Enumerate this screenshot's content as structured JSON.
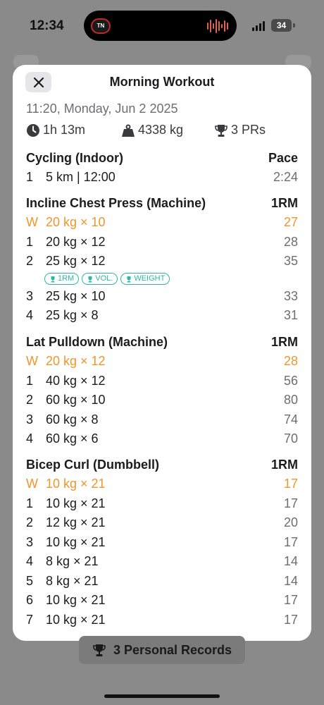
{
  "status_bar": {
    "time": "12:34",
    "battery": "34"
  },
  "modal": {
    "title": "Morning Workout",
    "datetime": "11:20, Monday, Jun 2 2025",
    "stats": {
      "duration": "1h 13m",
      "volume": "4338 kg",
      "prs": "3 PRs"
    }
  },
  "exercises": [
    {
      "name": "Cycling (Indoor)",
      "metric_label": "Pace",
      "sets": [
        {
          "num": "1",
          "desc": "5 km | 12:00",
          "metric": "2:24"
        }
      ]
    },
    {
      "name": "Incline Chest Press (Machine)",
      "metric_label": "1RM",
      "sets": [
        {
          "num": "W",
          "desc": "20 kg × 10",
          "metric": "27"
        },
        {
          "num": "1",
          "desc": "20 kg × 12",
          "metric": "28"
        },
        {
          "num": "2",
          "desc": "25 kg × 12",
          "metric": "35",
          "badges": [
            "1RM",
            "VOL.",
            "WEIGHT"
          ]
        },
        {
          "num": "3",
          "desc": "25 kg × 10",
          "metric": "33"
        },
        {
          "num": "4",
          "desc": "25 kg × 8",
          "metric": "31"
        }
      ]
    },
    {
      "name": "Lat Pulldown (Machine)",
      "metric_label": "1RM",
      "sets": [
        {
          "num": "W",
          "desc": "20 kg × 12",
          "metric": "28"
        },
        {
          "num": "1",
          "desc": "40 kg × 12",
          "metric": "56"
        },
        {
          "num": "2",
          "desc": "60 kg × 10",
          "metric": "80"
        },
        {
          "num": "3",
          "desc": "60 kg × 8",
          "metric": "74"
        },
        {
          "num": "4",
          "desc": "60 kg × 6",
          "metric": "70"
        }
      ]
    },
    {
      "name": "Bicep Curl (Dumbbell)",
      "metric_label": "1RM",
      "sets": [
        {
          "num": "W",
          "desc": "10 kg × 21",
          "metric": "17"
        },
        {
          "num": "1",
          "desc": "10 kg × 21",
          "metric": "17"
        },
        {
          "num": "2",
          "desc": "12 kg × 21",
          "metric": "20"
        },
        {
          "num": "3",
          "desc": "10 kg × 21",
          "metric": "17"
        },
        {
          "num": "4",
          "desc": "8 kg × 21",
          "metric": "14"
        },
        {
          "num": "5",
          "desc": "8 kg × 21",
          "metric": "14"
        },
        {
          "num": "6",
          "desc": "10 kg × 21",
          "metric": "17"
        },
        {
          "num": "7",
          "desc": "10 kg × 21",
          "metric": "17"
        }
      ]
    }
  ],
  "footer": {
    "records_label": "3 Personal Records"
  },
  "colors": {
    "warmup": "#f0962a",
    "pr_badge": "#2cb8a8",
    "secondary_text": "#6d6d72"
  },
  "icons": {
    "duration": "clock-icon",
    "volume": "weight-icon",
    "prs": "trophy-icon",
    "close": "close-icon",
    "badge": "trophy-icon"
  }
}
